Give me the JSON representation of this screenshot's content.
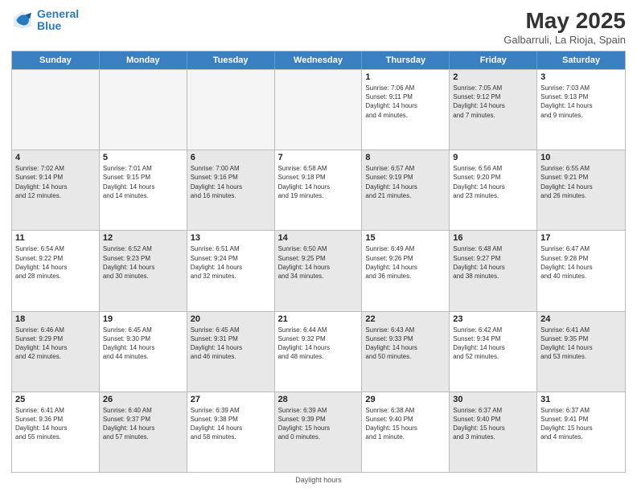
{
  "logo": {
    "line1": "General",
    "line2": "Blue"
  },
  "title": "May 2025",
  "subtitle": "Galbarruli, La Rioja, Spain",
  "header_days": [
    "Sunday",
    "Monday",
    "Tuesday",
    "Wednesday",
    "Thursday",
    "Friday",
    "Saturday"
  ],
  "footer": "Daylight hours",
  "rows": [
    [
      {
        "day": "",
        "empty": true,
        "info": ""
      },
      {
        "day": "",
        "empty": true,
        "info": ""
      },
      {
        "day": "",
        "empty": true,
        "info": ""
      },
      {
        "day": "",
        "empty": true,
        "info": ""
      },
      {
        "day": "1",
        "info": "Sunrise: 7:06 AM\nSunset: 9:11 PM\nDaylight: 14 hours\nand 4 minutes."
      },
      {
        "day": "2",
        "shaded": true,
        "info": "Sunrise: 7:05 AM\nSunset: 9:12 PM\nDaylight: 14 hours\nand 7 minutes."
      },
      {
        "day": "3",
        "info": "Sunrise: 7:03 AM\nSunset: 9:13 PM\nDaylight: 14 hours\nand 9 minutes."
      }
    ],
    [
      {
        "day": "4",
        "shaded": true,
        "info": "Sunrise: 7:02 AM\nSunset: 9:14 PM\nDaylight: 14 hours\nand 12 minutes."
      },
      {
        "day": "5",
        "info": "Sunrise: 7:01 AM\nSunset: 9:15 PM\nDaylight: 14 hours\nand 14 minutes."
      },
      {
        "day": "6",
        "shaded": true,
        "info": "Sunrise: 7:00 AM\nSunset: 9:16 PM\nDaylight: 14 hours\nand 16 minutes."
      },
      {
        "day": "7",
        "info": "Sunrise: 6:58 AM\nSunset: 9:18 PM\nDaylight: 14 hours\nand 19 minutes."
      },
      {
        "day": "8",
        "shaded": true,
        "info": "Sunrise: 6:57 AM\nSunset: 9:19 PM\nDaylight: 14 hours\nand 21 minutes."
      },
      {
        "day": "9",
        "info": "Sunrise: 6:56 AM\nSunset: 9:20 PM\nDaylight: 14 hours\nand 23 minutes."
      },
      {
        "day": "10",
        "shaded": true,
        "info": "Sunrise: 6:55 AM\nSunset: 9:21 PM\nDaylight: 14 hours\nand 26 minutes."
      }
    ],
    [
      {
        "day": "11",
        "info": "Sunrise: 6:54 AM\nSunset: 9:22 PM\nDaylight: 14 hours\nand 28 minutes."
      },
      {
        "day": "12",
        "shaded": true,
        "info": "Sunrise: 6:52 AM\nSunset: 9:23 PM\nDaylight: 14 hours\nand 30 minutes."
      },
      {
        "day": "13",
        "info": "Sunrise: 6:51 AM\nSunset: 9:24 PM\nDaylight: 14 hours\nand 32 minutes."
      },
      {
        "day": "14",
        "shaded": true,
        "info": "Sunrise: 6:50 AM\nSunset: 9:25 PM\nDaylight: 14 hours\nand 34 minutes."
      },
      {
        "day": "15",
        "info": "Sunrise: 6:49 AM\nSunset: 9:26 PM\nDaylight: 14 hours\nand 36 minutes."
      },
      {
        "day": "16",
        "shaded": true,
        "info": "Sunrise: 6:48 AM\nSunset: 9:27 PM\nDaylight: 14 hours\nand 38 minutes."
      },
      {
        "day": "17",
        "info": "Sunrise: 6:47 AM\nSunset: 9:28 PM\nDaylight: 14 hours\nand 40 minutes."
      }
    ],
    [
      {
        "day": "18",
        "shaded": true,
        "info": "Sunrise: 6:46 AM\nSunset: 9:29 PM\nDaylight: 14 hours\nand 42 minutes."
      },
      {
        "day": "19",
        "info": "Sunrise: 6:45 AM\nSunset: 9:30 PM\nDaylight: 14 hours\nand 44 minutes."
      },
      {
        "day": "20",
        "shaded": true,
        "info": "Sunrise: 6:45 AM\nSunset: 9:31 PM\nDaylight: 14 hours\nand 46 minutes."
      },
      {
        "day": "21",
        "info": "Sunrise: 6:44 AM\nSunset: 9:32 PM\nDaylight: 14 hours\nand 48 minutes."
      },
      {
        "day": "22",
        "shaded": true,
        "info": "Sunrise: 6:43 AM\nSunset: 9:33 PM\nDaylight: 14 hours\nand 50 minutes."
      },
      {
        "day": "23",
        "info": "Sunrise: 6:42 AM\nSunset: 9:34 PM\nDaylight: 14 hours\nand 52 minutes."
      },
      {
        "day": "24",
        "shaded": true,
        "info": "Sunrise: 6:41 AM\nSunset: 9:35 PM\nDaylight: 14 hours\nand 53 minutes."
      }
    ],
    [
      {
        "day": "25",
        "info": "Sunrise: 6:41 AM\nSunset: 9:36 PM\nDaylight: 14 hours\nand 55 minutes."
      },
      {
        "day": "26",
        "shaded": true,
        "info": "Sunrise: 6:40 AM\nSunset: 9:37 PM\nDaylight: 14 hours\nand 57 minutes."
      },
      {
        "day": "27",
        "info": "Sunrise: 6:39 AM\nSunset: 9:38 PM\nDaylight: 14 hours\nand 58 minutes."
      },
      {
        "day": "28",
        "shaded": true,
        "info": "Sunrise: 6:39 AM\nSunset: 9:39 PM\nDaylight: 15 hours\nand 0 minutes."
      },
      {
        "day": "29",
        "info": "Sunrise: 6:38 AM\nSunset: 9:40 PM\nDaylight: 15 hours\nand 1 minute."
      },
      {
        "day": "30",
        "shaded": true,
        "info": "Sunrise: 6:37 AM\nSunset: 9:40 PM\nDaylight: 15 hours\nand 3 minutes."
      },
      {
        "day": "31",
        "info": "Sunrise: 6:37 AM\nSunset: 9:41 PM\nDaylight: 15 hours\nand 4 minutes."
      }
    ]
  ]
}
